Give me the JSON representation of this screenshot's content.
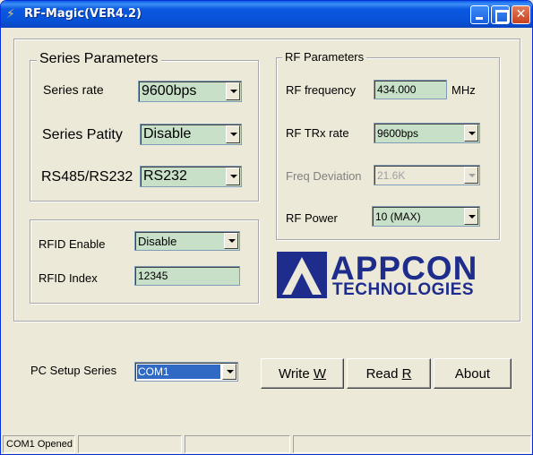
{
  "window": {
    "title": "RF-Magic(VER4.2)",
    "icon": "antenna-icon"
  },
  "series_params": {
    "title": "Series Parameters",
    "rate_label": "Series rate",
    "rate_value": "9600bps",
    "parity_label": "Series Patity",
    "parity_value": "Disable",
    "interface_label": "RS485/RS232",
    "interface_value": "RS232"
  },
  "rfid": {
    "enable_label": "RFID Enable",
    "enable_value": "Disable",
    "index_label": "RFID Index",
    "index_value": "12345"
  },
  "rf_params": {
    "title": "RF Parameters",
    "freq_label": "RF frequency",
    "freq_value": "434.000",
    "freq_unit": "MHz",
    "trx_label": "RF TRx rate",
    "trx_value": "9600bps",
    "dev_label": "Freq  Deviation",
    "dev_value": "21.6K",
    "power_label": "RF Power",
    "power_value": "10 (MAX)"
  },
  "logo": {
    "main": "APPCON",
    "sub": "TECHNOLOGIES"
  },
  "pc_setup": {
    "label": "PC Setup Series",
    "value": "COM1"
  },
  "buttons": {
    "write_text": "Write ",
    "write_key": "W",
    "read_text": "Read ",
    "read_key": "R",
    "about": "About"
  },
  "status": {
    "pane1": "COM1 Opened",
    "pane2": "",
    "pane3": "",
    "pane4": ""
  },
  "colors": {
    "field_bg": "#c8e0c8",
    "title_bar": "#0753d8",
    "logo": "#1e2c8c"
  }
}
